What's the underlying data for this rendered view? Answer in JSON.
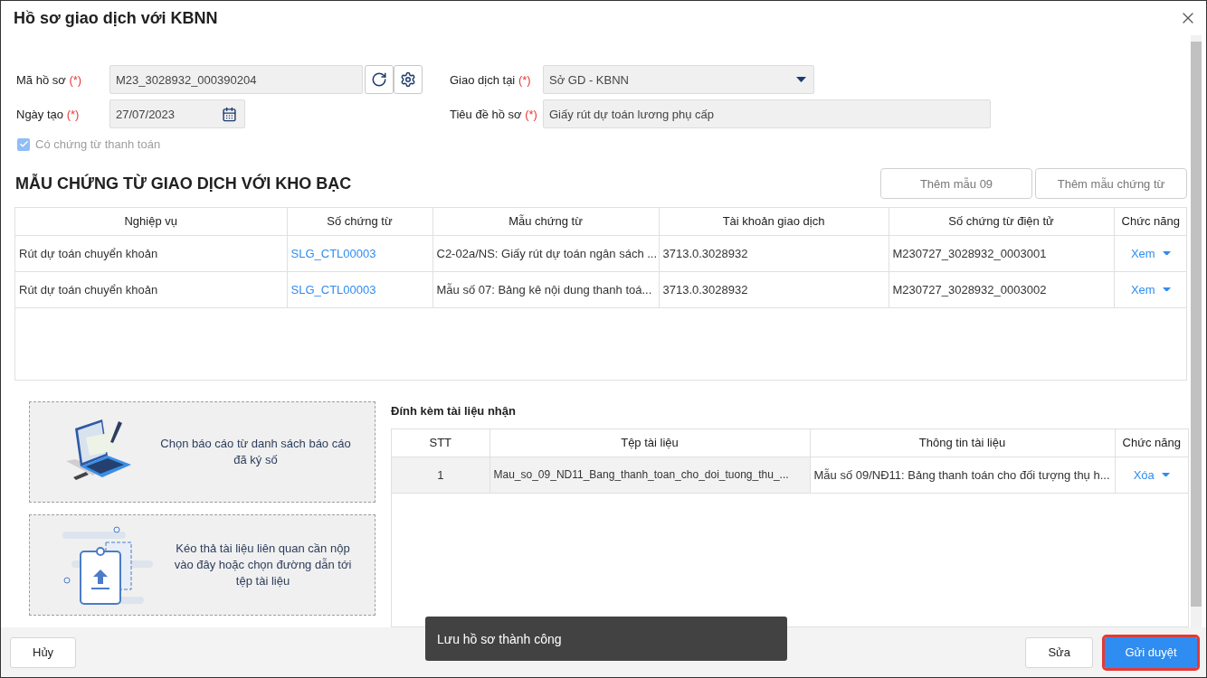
{
  "dialog": {
    "title": "Hồ sơ giao dịch với KBNN"
  },
  "form": {
    "fields": [
      {
        "kind": "code",
        "label": "Mã hồ sơ",
        "required_mark": "(*)",
        "value": "M23_3028932_000390204"
      },
      {
        "kind": "select",
        "label": "Giao dịch tại",
        "required_mark": "(*)",
        "value": "Sở GD - KBNN"
      },
      {
        "kind": "date",
        "label": "Ngày tạo",
        "required_mark": "(*)",
        "value": "27/07/2023"
      },
      {
        "kind": "text",
        "label": "Tiêu đề hồ sơ",
        "required_mark": "(*)",
        "value": "Giấy rút dự toán lương phụ cấp"
      }
    ],
    "checkbox": {
      "label": "Có chứng từ thanh toán",
      "checked": true,
      "disabled": true
    }
  },
  "vouchers": {
    "title": "MẪU CHỨNG TỪ GIAO DỊCH VỚI KHO BẠC",
    "buttons": [
      "Thêm mẫu 09",
      "Thêm mẫu chứng từ"
    ],
    "columns": [
      "Nghiệp vụ",
      "Số chứng từ",
      "Mẫu chứng từ",
      "Tài khoản giao dịch",
      "Số chứng từ điện tử",
      "Chức năng"
    ],
    "rows": [
      {
        "operation": "Rút dự toán chuyển khoản",
        "number": "SLG_CTL00003",
        "template": "C2-02a/NS: Giấy rút dự toán ngân sách ...",
        "account": "3713.0.3028932",
        "e_number": "M230727_3028932_0003001",
        "action": "Xem"
      },
      {
        "operation": "Rút dự toán chuyển khoản",
        "number": "SLG_CTL00003",
        "template": "Mẫu số 07: Bảng kê nội dung thanh toá...",
        "account": "3713.0.3028932",
        "e_number": "M230727_3028932_0003002",
        "action": "Xem"
      }
    ]
  },
  "upload": {
    "cards": [
      {
        "kind": "signed",
        "text": "Chọn báo cáo từ danh sách báo cáo đã ký số"
      },
      {
        "kind": "drop",
        "text": "Kéo thả tài liệu liên quan cần nộp vào đây hoặc chọn đường dẫn tới tệp tài liệu"
      }
    ]
  },
  "attachments": {
    "title": "Đính kèm tài liệu nhận",
    "columns": [
      "STT",
      "Tệp tài liệu",
      "Thông tin tài liệu",
      "Chức năng"
    ],
    "rows": [
      {
        "index": "1",
        "file": "Mau_so_09_ND11_Bang_thanh_toan_cho_doi_tuong_thu_...",
        "info": "Mẫu số 09/NĐ11: Bảng thanh toán cho đối tượng thụ h...",
        "action": "Xóa",
        "selected": true
      }
    ]
  },
  "footer": {
    "cancel": "Hủy",
    "edit": "Sửa",
    "submit": {
      "label": "Gửi duyệt",
      "highlighted": true
    }
  },
  "toast": {
    "message": "Lưu hồ sơ thành công"
  }
}
